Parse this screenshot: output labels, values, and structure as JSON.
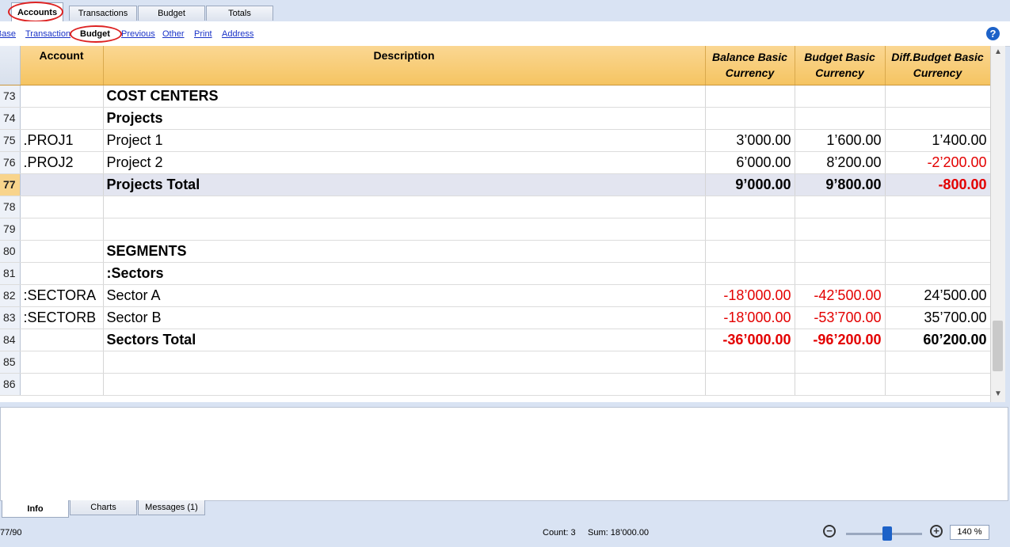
{
  "top_tabs": [
    {
      "label": "Accounts"
    },
    {
      "label": "Transactions"
    },
    {
      "label": "Budget"
    },
    {
      "label": "Totals"
    }
  ],
  "views": [
    {
      "label": "Base"
    },
    {
      "label": "Transaction"
    },
    {
      "label": "Budget"
    },
    {
      "label": "Previous"
    },
    {
      "label": "Other"
    },
    {
      "label": "Print"
    },
    {
      "label": "Address"
    }
  ],
  "help": {
    "glyph": "?"
  },
  "columns": {
    "account": "Account",
    "description": "Description",
    "balance": [
      "Balance Basic",
      "Currency"
    ],
    "budget": [
      "Budget Basic",
      "Currency"
    ],
    "diff": [
      "Diff.Budget Basic",
      "Currency"
    ]
  },
  "rows": [
    {
      "n": "73",
      "account": "",
      "description": "COST CENTERS",
      "balance": "",
      "budget": "",
      "diff": ""
    },
    {
      "n": "74",
      "account": "",
      "description": "Projects",
      "balance": "",
      "budget": "",
      "diff": ""
    },
    {
      "n": "75",
      "account": ".PROJ1",
      "description": "Project 1",
      "balance": "3’000.00",
      "budget": "1’600.00",
      "diff": "1’400.00"
    },
    {
      "n": "76",
      "account": ".PROJ2",
      "description": "Project 2",
      "balance": "6’000.00",
      "budget": "8’200.00",
      "diff": "-2’200.00"
    },
    {
      "n": "77",
      "account": "",
      "description": "Projects Total",
      "balance": "9’000.00",
      "budget": "9’800.00",
      "diff": "-800.00"
    },
    {
      "n": "78",
      "account": "",
      "description": "",
      "balance": "",
      "budget": "",
      "diff": ""
    },
    {
      "n": "79",
      "account": "",
      "description": "",
      "balance": "",
      "budget": "",
      "diff": ""
    },
    {
      "n": "80",
      "account": "",
      "description": "SEGMENTS",
      "balance": "",
      "budget": "",
      "diff": ""
    },
    {
      "n": "81",
      "account": "",
      "description": ":Sectors",
      "balance": "",
      "budget": "",
      "diff": ""
    },
    {
      "n": "82",
      "account": ":SECTORA",
      "description": "Sector A",
      "balance": "-18’000.00",
      "budget": "-42’500.00",
      "diff": "24’500.00"
    },
    {
      "n": "83",
      "account": ":SECTORB",
      "description": "Sector B",
      "balance": "-18’000.00",
      "budget": "-53’700.00",
      "diff": "35’700.00"
    },
    {
      "n": "84",
      "account": "",
      "description": "Sectors Total",
      "balance": "-36’000.00",
      "budget": "-96’200.00",
      "diff": "60’200.00"
    },
    {
      "n": "85",
      "account": "",
      "description": "",
      "balance": "",
      "budget": "",
      "diff": ""
    },
    {
      "n": "86",
      "account": "",
      "description": "",
      "balance": "",
      "budget": "",
      "diff": ""
    }
  ],
  "scroll": {
    "up": "▲",
    "down": "▼"
  },
  "bottom_tabs": [
    {
      "label": "Info"
    },
    {
      "label": "Charts"
    },
    {
      "label": "Messages (1)"
    }
  ],
  "status": {
    "position": "77/90",
    "count": "Count: 3",
    "sum": "Sum: 18’000.00",
    "zoom_out": "−",
    "zoom_in": "+",
    "zoom": "140 %"
  },
  "colors": {
    "negative": "#e30000",
    "header": "#f5c462",
    "selected_row": "#f8d48c",
    "link": "#1a33c8"
  }
}
